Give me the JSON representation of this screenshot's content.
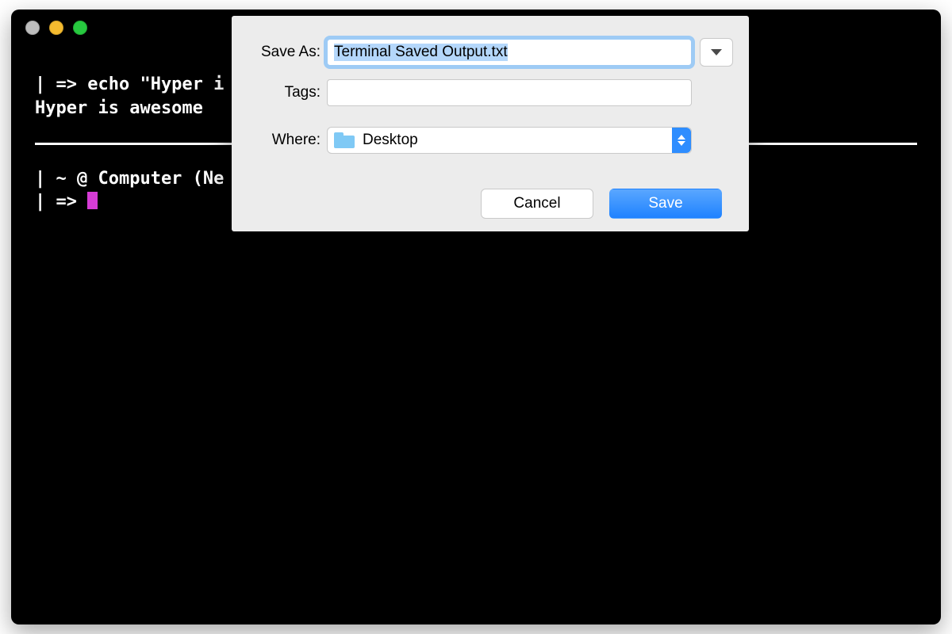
{
  "terminal": {
    "lines": {
      "l1": "| => echo \"Hyper i",
      "l2": "Hyper is awesome",
      "l3": "| ~ @ Computer (Ne",
      "l4": "| => "
    }
  },
  "dialog": {
    "labels": {
      "save_as": "Save As:",
      "tags": "Tags:",
      "where": "Where:"
    },
    "save_as_value": "Terminal Saved Output.txt",
    "tags_value": "",
    "where_value": "Desktop",
    "buttons": {
      "cancel": "Cancel",
      "save": "Save"
    }
  }
}
